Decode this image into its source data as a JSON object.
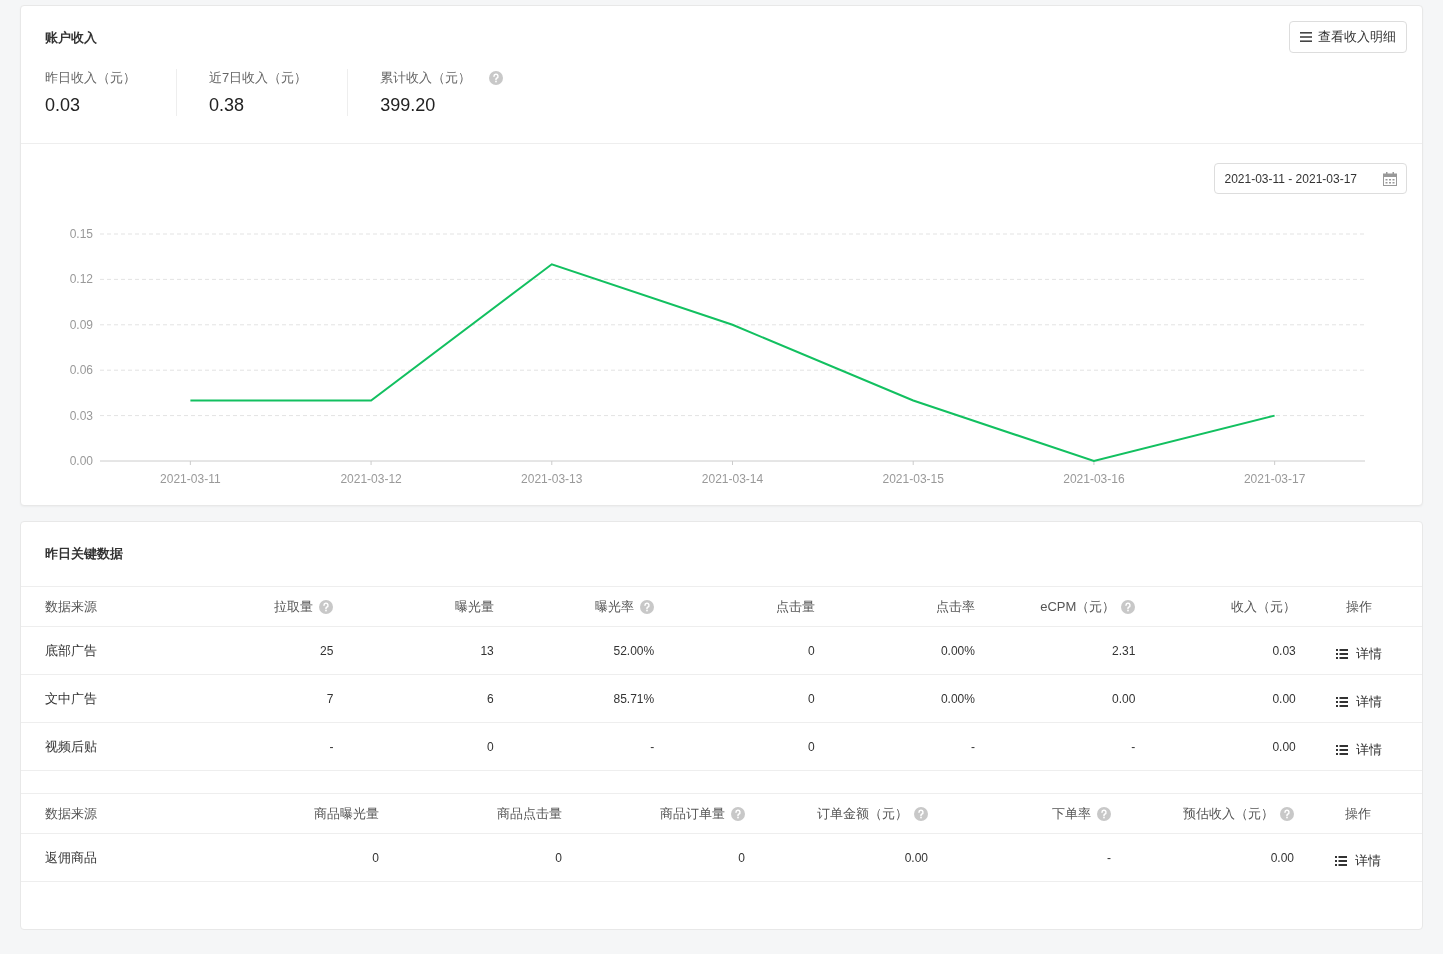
{
  "income": {
    "title": "账户收入",
    "detail_button": "查看收入明细",
    "stats": [
      {
        "label": "昨日收入（元）",
        "value": "0.03",
        "help": false
      },
      {
        "label": "近7日收入（元）",
        "value": "0.38",
        "help": false
      },
      {
        "label": "累计收入（元）",
        "value": "399.20",
        "help": true
      }
    ],
    "date_range": "2021-03-11 - 2021-03-17",
    "chart_data": {
      "type": "line",
      "categories": [
        "2021-03-11",
        "2021-03-12",
        "2021-03-13",
        "2021-03-14",
        "2021-03-15",
        "2021-03-16",
        "2021-03-17"
      ],
      "grid": true,
      "series": [
        {
          "color": "#12c060",
          "values": [
            0.04,
            0.04,
            0.13,
            0.09,
            0.04,
            0.0,
            0.03
          ]
        }
      ],
      "ylim": [
        0,
        0.15
      ],
      "yticks": [
        {
          "value": 0,
          "label": "0.00"
        },
        {
          "value": 0.03,
          "label": "0.03"
        },
        {
          "value": 0.06,
          "label": "0.06"
        },
        {
          "value": 0.09,
          "label": "0.09"
        },
        {
          "value": 0.12,
          "label": "0.12"
        },
        {
          "value": 0.15,
          "label": "0.15"
        }
      ]
    }
  },
  "key_data": {
    "title": "昨日关键数据",
    "tables": [
      {
        "columns": [
          {
            "label": "数据来源",
            "help": false
          },
          {
            "label": "拉取量",
            "help": true
          },
          {
            "label": "曝光量",
            "help": false
          },
          {
            "label": "曝光率",
            "help": true
          },
          {
            "label": "点击量",
            "help": false
          },
          {
            "label": "点击率",
            "help": false
          },
          {
            "label": "eCPM（元）",
            "help": true
          },
          {
            "label": "收入（元）",
            "help": false
          },
          {
            "label": "操作",
            "help": false
          }
        ],
        "rows": [
          {
            "cells": [
              "底部广告",
              "25",
              "13",
              "52.00%",
              "0",
              "0.00%",
              "2.31",
              "0.03"
            ],
            "action": "详情"
          },
          {
            "cells": [
              "文中广告",
              "7",
              "6",
              "85.71%",
              "0",
              "0.00%",
              "0.00",
              "0.00"
            ],
            "action": "详情"
          },
          {
            "cells": [
              "视频后贴",
              "-",
              "0",
              "-",
              "0",
              "-",
              "-",
              "0.00"
            ],
            "action": "详情"
          }
        ]
      },
      {
        "columns": [
          {
            "label": "数据来源",
            "help": false
          },
          {
            "label": "商品曝光量",
            "help": false
          },
          {
            "label": "商品点击量",
            "help": false
          },
          {
            "label": "商品订单量",
            "help": true
          },
          {
            "label": "订单金额（元）",
            "help": true
          },
          {
            "label": "下单率",
            "help": true
          },
          {
            "label": "预估收入（元）",
            "help": true
          },
          {
            "label": "操作",
            "help": false
          }
        ],
        "rows": [
          {
            "cells": [
              "返佣商品",
              "0",
              "0",
              "0",
              "0.00",
              "-",
              "0.00"
            ],
            "action": "详情"
          }
        ]
      }
    ]
  }
}
